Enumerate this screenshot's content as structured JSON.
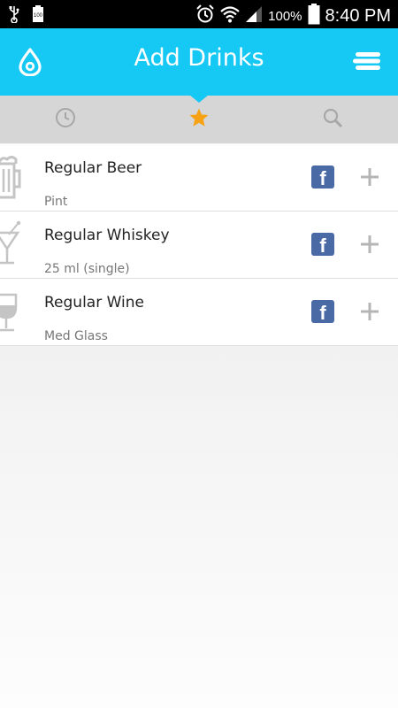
{
  "status_bar": {
    "battery_percent": "100%",
    "time": "8:40 PM",
    "battery_icon_text": "100"
  },
  "header": {
    "title": "Add Drinks"
  },
  "tabs": [
    {
      "name": "history",
      "icon": "clock-icon",
      "selected": false
    },
    {
      "name": "favorites",
      "icon": "star-icon",
      "selected": true
    },
    {
      "name": "search",
      "icon": "search-icon",
      "selected": false
    }
  ],
  "drinks": [
    {
      "name": "Regular Beer",
      "size": "Pint",
      "icon": "beer-mug-icon"
    },
    {
      "name": "Regular Whiskey",
      "size": "25 ml (single)",
      "icon": "cocktail-glass-icon"
    },
    {
      "name": "Regular Wine",
      "size": "Med Glass",
      "icon": "wine-glass-icon"
    }
  ],
  "colors": {
    "accent": "#16c8f4",
    "star": "#f6a214",
    "facebook": "#4a6aa5",
    "icon_gray": "#c4c4c4"
  }
}
